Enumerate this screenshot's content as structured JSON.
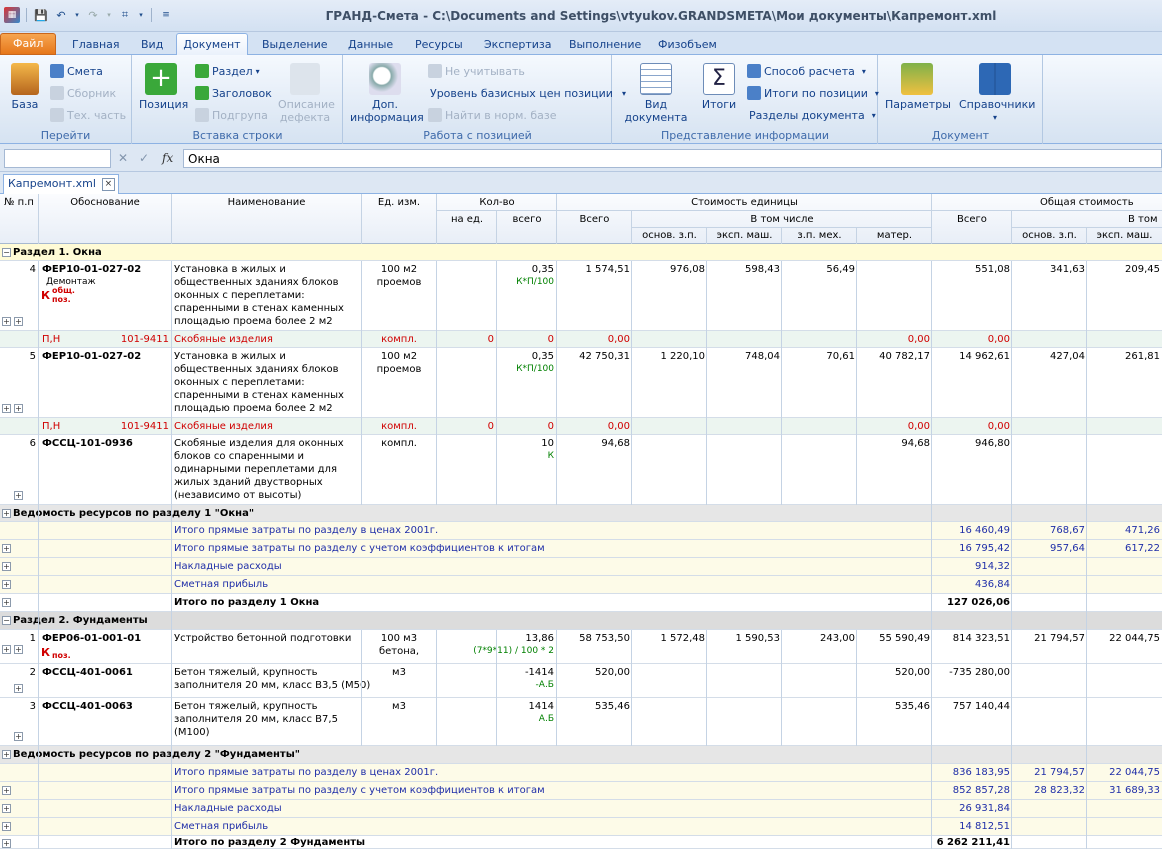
{
  "app": {
    "title": "ГРАНД-Смета - C:\\Documents and Settings\\vtyukov.GRANDSMETA\\Мои документы\\Капремонт.xml"
  },
  "tabs": [
    "Файл",
    "Главная",
    "Вид",
    "Документ",
    "Выделение",
    "Данные",
    "Ресурсы",
    "Экспертиза",
    "Выполнение",
    "Физобъем"
  ],
  "ribbon": {
    "g1": {
      "label": "Перейти",
      "big": "База",
      "items": [
        "Смета",
        "Сборник",
        "Тех. часть"
      ]
    },
    "g2": {
      "label": "Вставка строки",
      "big": "Позиция",
      "items": [
        "Раздел",
        "Заголовок",
        "Подгрупа"
      ],
      "big2": "Описание дефекта"
    },
    "g3": {
      "label": "Работа с позицией",
      "big": "Доп. информация",
      "items": [
        "Не учитывать",
        "Уровень базисных цен позиции",
        "Найти в норм. базе"
      ]
    },
    "g4": {
      "label": "Представление информации",
      "big": "Вид документа",
      "big2": "Итоги",
      "items": [
        "Способ расчета",
        "Итоги по позиции",
        "Разделы документа"
      ]
    },
    "g5": {
      "label": "Документ",
      "big": "Параметры",
      "big2": "Справочники"
    }
  },
  "formula": {
    "namebox": "",
    "value": "Окна",
    "fx": "fx"
  },
  "doc_tab": {
    "label": "Капремонт.xml",
    "close": "×"
  },
  "header": {
    "num": "№ п.п",
    "basis": "Обоснование",
    "name": "Наименование",
    "unit": "Ед. изм.",
    "qty": "Кол-во",
    "qty_per": "на ед.",
    "qty_all": "всего",
    "unit_cost": "Стоимость единицы",
    "total": "Всего",
    "incl": "В том числе",
    "osn": "основ. з.п.",
    "eksp": "эксп. маш.",
    "zpmeh": "з.п. мех.",
    "mater": "матер.",
    "gen_cost": "Общая стоимость",
    "gen_total": "Всего",
    "gen_incl": "В том",
    "gen_osn": "основ. з.п.",
    "gen_eksp": "эксп. маш."
  },
  "rows": {
    "s1": "Раздел 1. Окна",
    "p4": {
      "num": "4",
      "code": "ФЕР10-01-027-02",
      "note": "Демонтаж",
      "k": "К",
      "k1": "общ.",
      "k2": "поз.",
      "name": "Установка в жилых и общественных зданиях блоков оконных с переплетами: спаренными в стенах каменных площадью проема более 2 м2",
      "name_l": [
        "Установка в жилых и",
        "общественных зданиях блоков",
        "оконных с переплетами:",
        "спаренными в стенах каменных",
        "площадью проема более 2 м2"
      ],
      "unit": "100 м2",
      "unit2": "проемов",
      "qty": "0,35",
      "qtyf": "К*П/100",
      "total": "1 574,51",
      "osn": "976,08",
      "eksp": "598,43",
      "zpmeh": "56,49",
      "mater": "",
      "g_total": "551,08",
      "g_osn": "341,63",
      "g_eksp": "209,45"
    },
    "m4": {
      "type": "П,Н",
      "code": "101-9411",
      "name": "Скобяные изделия",
      "unit": "компл.",
      "a": "0",
      "b": "0",
      "c": "0,00",
      "d": "0,00",
      "e": "0,00"
    },
    "p5": {
      "num": "5",
      "code": "ФЕР10-01-027-02",
      "name_l": [
        "Установка в жилых и",
        "общественных зданиях блоков",
        "оконных с переплетами:",
        "спаренными в стенах каменных",
        "площадью проема более 2 м2"
      ],
      "unit": "100 м2",
      "unit2": "проемов",
      "qty": "0,35",
      "qtyf": "К*П/100",
      "total": "42 750,31",
      "osn": "1 220,10",
      "eksp": "748,04",
      "zpmeh": "70,61",
      "mater": "40 782,17",
      "g_total": "14 962,61",
      "g_osn": "427,04",
      "g_eksp": "261,81"
    },
    "m5": {
      "type": "П,Н",
      "code": "101-9411",
      "name": "Скобяные изделия",
      "unit": "компл.",
      "a": "0",
      "b": "0",
      "c": "0,00",
      "d": "0,00",
      "e": "0,00"
    },
    "p6": {
      "num": "6",
      "code": "ФССЦ-101-0936",
      "name_l": [
        "Скобяные изделия для оконных",
        "блоков со спаренными и",
        "одинарными переплетами для",
        "жилых зданий двустворных",
        "(независимо от высоты)"
      ],
      "unit": "компл.",
      "qty": "10",
      "qtyf": "К",
      "total": "94,68",
      "mater": "94,68",
      "g_total": "946,80"
    },
    "v1": "Ведомость ресурсов по разделу 1 \"Окна\"",
    "t1a": {
      "name": "Итого прямые затраты по разделу в ценах 2001г.",
      "g_total": "16 460,49",
      "g_osn": "768,67",
      "g_eksp": "471,26"
    },
    "t1b": {
      "name": "Итого прямые затраты по разделу с учетом коэффициентов к итогам",
      "g_total": "16 795,42",
      "g_osn": "957,64",
      "g_eksp": "617,22"
    },
    "t1c": {
      "name": "Накладные расходы",
      "g_total": "914,32"
    },
    "t1d": {
      "name": "Сметная прибыль",
      "g_total": "436,84"
    },
    "t1e": {
      "name": "Итого по разделу 1 Окна",
      "g_total": "127 026,06"
    },
    "s2": "Раздел 2. Фундаменты",
    "q1": {
      "num": "1",
      "code": "ФЕР06-01-001-01",
      "k": "К",
      "k2": "поз.",
      "name": "Устройство бетонной подготовки",
      "unit": "100 м3",
      "unit2": "бетона,",
      "qty": "13,86",
      "qtyf": "(7*9*11) / 100 * 2",
      "total": "58 753,50",
      "osn": "1 572,48",
      "eksp": "1 590,53",
      "zpmeh": "243,00",
      "mater": "55 590,49",
      "g_total": "814 323,51",
      "g_osn": "21 794,57",
      "g_eksp": "22 044,75"
    },
    "q2": {
      "num": "2",
      "code": "ФССЦ-401-0061",
      "name_l": [
        "Бетон тяжелый, крупность",
        "заполнителя 20 мм, класс В3,5 (М50)"
      ],
      "unit": "м3",
      "qty": "-1414",
      "qtyf": "-А.Б",
      "total": "520,00",
      "mater": "520,00",
      "g_total": "-735 280,00"
    },
    "q3": {
      "num": "3",
      "code": "ФССЦ-401-0063",
      "name_l": [
        "Бетон тяжелый, крупность",
        "заполнителя 20 мм, класс В7,5",
        "(М100)"
      ],
      "unit": "м3",
      "qty": "1414",
      "qtyf": "А.Б",
      "total": "535,46",
      "mater": "535,46",
      "g_total": "757 140,44"
    },
    "v2": "Ведомость ресурсов по разделу 2 \"Фундаменты\"",
    "t2a": {
      "name": "Итого прямые затраты по разделу в ценах 2001г.",
      "g_total": "836 183,95",
      "g_osn": "21 794,57",
      "g_eksp": "22 044,75"
    },
    "t2b": {
      "name": "Итого прямые затраты по разделу с учетом коэффициентов к итогам",
      "g_total": "852 857,28",
      "g_osn": "28 823,32",
      "g_eksp": "31 689,33"
    },
    "t2c": {
      "name": "Накладные расходы",
      "g_total": "26 931,84"
    },
    "t2d": {
      "name": "Сметная прибыль",
      "g_total": "14 812,51"
    },
    "t2e": {
      "name": "Итого по разделу 2 Фундаменты",
      "g_total": "6 262 211,41"
    }
  },
  "colors": {
    "accent": "#15428b",
    "file_tab": "#e6771a",
    "section_bg": "#fffbd6",
    "material": "#d00000",
    "formula": "#008000",
    "totals": "#1f2ea8"
  }
}
